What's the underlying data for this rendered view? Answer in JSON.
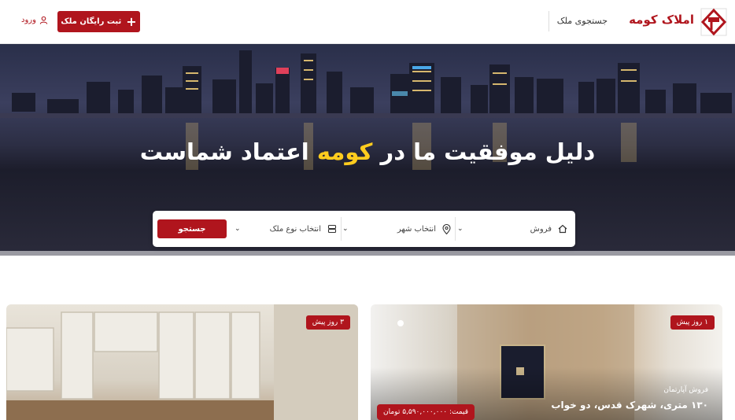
{
  "header": {
    "brand": "املاک کومه",
    "nav_search": "جستجوی ملک",
    "register_button": "ثبت رایگان ملک",
    "login": "ورود"
  },
  "hero": {
    "title_part1": "دلیل موفقیت ما در ",
    "title_highlight": "کومه",
    "title_part2": " اعتماد شماست"
  },
  "search": {
    "deal_type": "فروش",
    "city": "انتخاب شهر",
    "property_type": "انتخاب نوع ملک",
    "button": "جستجو"
  },
  "listings": [
    {
      "badge": "۱ روز پیش",
      "type": "فروش آپارتمان",
      "title": "۱۳۰ متری، شهرک قدس، دو خواب",
      "price": "قیمت: ۵,۵۹۰,۰۰۰,۰۰۰ تومان"
    },
    {
      "badge": "۳ روز پیش"
    }
  ],
  "colors": {
    "brand": "#b0151d",
    "highlight": "#ffcc1e"
  }
}
